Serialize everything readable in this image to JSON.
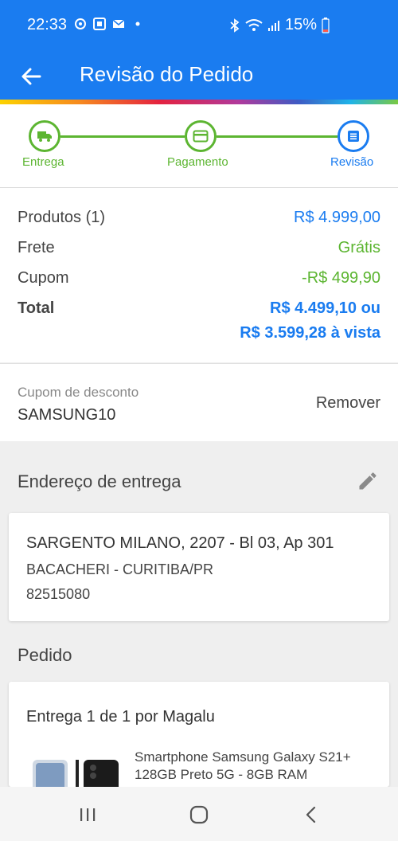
{
  "status": {
    "time": "22:33",
    "battery": "15%"
  },
  "header": {
    "title": "Revisão do Pedido"
  },
  "steps": [
    {
      "label": "Entrega"
    },
    {
      "label": "Pagamento"
    },
    {
      "label": "Revisão"
    }
  ],
  "summary": {
    "products_label": "Produtos (1)",
    "products_value": "R$ 4.999,00",
    "shipping_label": "Frete",
    "shipping_value": "Grátis",
    "coupon_label": "Cupom",
    "coupon_value": "-R$ 499,90",
    "total_label": "Total",
    "total_line1": "R$ 4.499,10 ou",
    "total_line2": "R$ 3.599,28 à vista"
  },
  "coupon": {
    "label": "Cupom de desconto",
    "code": "SAMSUNG10",
    "remove_label": "Remover"
  },
  "address": {
    "section_title": "Endereço de entrega",
    "line1": "SARGENTO MILANO, 2207 - Bl 03, Ap 301",
    "line2": "BACACHERI - CURITIBA/PR",
    "line3": "82515080"
  },
  "order": {
    "section_title": "Pedido",
    "delivery_label": "Entrega 1 de 1 por Magalu",
    "product_name": "Smartphone Samsung Galaxy S21+ 128GB Preto 5G - 8GB RAM"
  },
  "colors": {
    "brand_blue": "#1a7cf0",
    "success_green": "#5cb531"
  }
}
